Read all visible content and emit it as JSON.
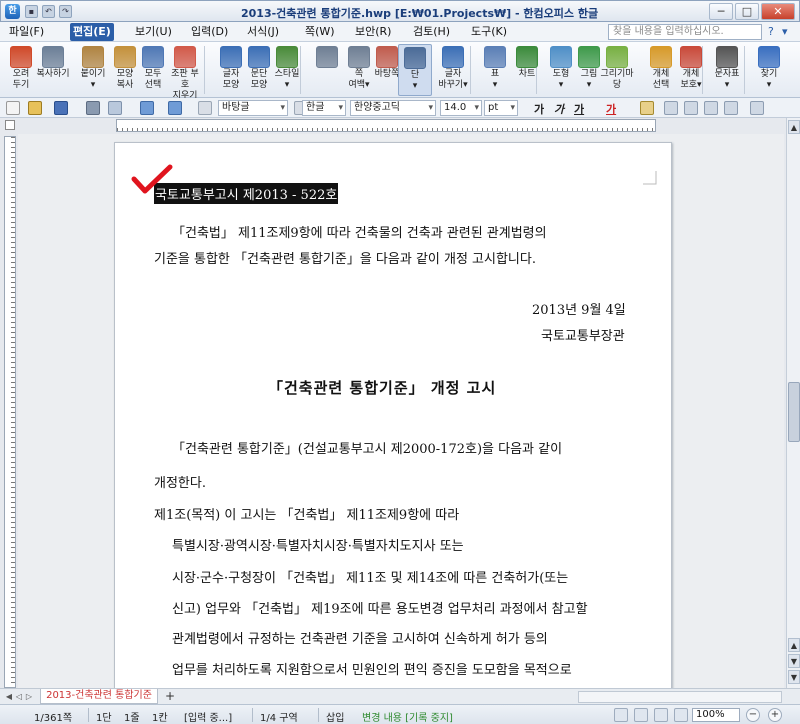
{
  "window": {
    "title": "2013-건축관련 통합기준.hwp [E:₩01.Projects₩] - 한컴오피스 한글",
    "logo": "한",
    "minimize": "─",
    "maximize": "□",
    "close": "✕"
  },
  "menu": {
    "items": [
      "파일(F)",
      "편집(E)",
      "보기(U)",
      "입력(D)",
      "서식(J)",
      "쪽(W)",
      "보안(R)",
      "검토(H)",
      "도구(K)"
    ],
    "active_index": 1,
    "search_placeholder": "찾을 내용을 입력하십시오.",
    "help": "?",
    "settings": "▾"
  },
  "ribbon": {
    "buttons": [
      {
        "label": "오려\n두기",
        "icon": "scissors-icon",
        "color": "#d04a2a"
      },
      {
        "label": "복사하기",
        "icon": "copy-icon",
        "color": "#6c7f97"
      },
      {
        "label": "붙이기\n▾",
        "icon": "paste-icon",
        "color": "#b08442"
      },
      {
        "label": "모양\n복사",
        "icon": "format-painter-icon",
        "color": "#c4913c"
      },
      {
        "label": "모두\n선택",
        "icon": "select-all-icon",
        "color": "#4f78b5"
      },
      {
        "label": "조판 부호\n지우기",
        "icon": "clear-format-icon",
        "color": "#d25a4a"
      },
      {
        "label": "글자\n모양",
        "icon": "char-shape-icon",
        "color": "#3c6fb6"
      },
      {
        "label": "문단\n모양",
        "icon": "paragraph-shape-icon",
        "color": "#3c6fb6"
      },
      {
        "label": "스타일\n▾",
        "icon": "style-icon",
        "color": "#4a8b3a"
      },
      {
        "label": "",
        "icon": "page-icon",
        "color": "#6f7f94"
      },
      {
        "label": "쪽\n여백▾",
        "icon": "margin-icon",
        "color": "#6f7f94"
      },
      {
        "label": "바탕쪽",
        "icon": "master-page-icon",
        "color": "#c05c4e"
      },
      {
        "label": "단\n▾",
        "icon": "columns-icon",
        "color": "#4c6c98"
      },
      {
        "label": "글자\n바꾸기▾",
        "icon": "replace-text-icon",
        "color": "#3c6fb6"
      },
      {
        "label": "표\n▾",
        "icon": "table-icon",
        "color": "#5b7fb6"
      },
      {
        "label": "차트",
        "icon": "chart-icon",
        "color": "#3c8b3c"
      },
      {
        "label": "도형\n▾",
        "icon": "shape-icon",
        "color": "#4f8fc7"
      },
      {
        "label": "그림\n▾",
        "icon": "picture-icon",
        "color": "#3f9a4b"
      },
      {
        "label": "그리기마당",
        "icon": "clipart-icon",
        "color": "#78b043"
      },
      {
        "label": "개체\n선택",
        "icon": "object-select-icon",
        "color": "#d79a2a"
      },
      {
        "label": "개체\n보호▾",
        "icon": "object-protect-icon",
        "color": "#c94a3a"
      },
      {
        "label": "문자표\n▾",
        "icon": "symbol-icon",
        "color": "#555555"
      },
      {
        "label": "찾기\n▾",
        "icon": "find-icon",
        "color": "#3a6fc0"
      }
    ]
  },
  "format_bar": {
    "style": "바탕글",
    "language": "한글",
    "font": "한양중고딕",
    "size": "14.0",
    "unit": "pt",
    "bold": "가",
    "italic": "가",
    "underline": "가",
    "font_color": "가"
  },
  "document": {
    "lines": [
      "국토교통부고시 제2013 - 522호",
      "「건축법」 제11조제9항에 따라 건축물의 건축과 관련된 관계법령의",
      "기준을 통합한 「건축관련 통합기준」을 다음과 같이 개정 고시합니다.",
      "2013년   9월  4일",
      "국토교통부장관",
      "「건축관련  통합기준」  개정  고시",
      "「건축관련 통합기준」(건설교통부고시 제2000-172호)을 다음과 같이",
      "개정한다.",
      "제1조(목적) 이 고시는 「건축법」 제11조제9항에 따라",
      "특별시장·광역시장·특별자치시장·특별자치도지사 또는",
      "시장·군수·구청장이 「건축법」 제11조 및 제14조에 따른 건축허가(또는",
      "신고) 업무와 「건축법」 제19조에 따른 용도변경 업무처리 과정에서 참고할",
      "관계법령에서 규정하는 건축관련 기준을 고시하여 신속하게 허가 등의",
      "업무를 처리하도록 지원함으로서 민원인의 편익 증진을 도모함을 목적으로"
    ]
  },
  "tabs": {
    "doc_tab": "2013-건축관련 통합기준",
    "add": "+"
  },
  "status": {
    "page": "1/361쪽",
    "section": "1단",
    "line": "1줄",
    "column": "1칸",
    "mode": "[입력 중...]",
    "area": "1/4 구역",
    "insert": "삽입",
    "track_changes": "변경 내용 [기록 중지]",
    "zoom": "100%",
    "zoom_out": "−",
    "zoom_in": "+"
  },
  "colors": {
    "accent": "#2b5ea8",
    "annotation_red": "#e0141e",
    "track_green": "#2f8a2f"
  }
}
